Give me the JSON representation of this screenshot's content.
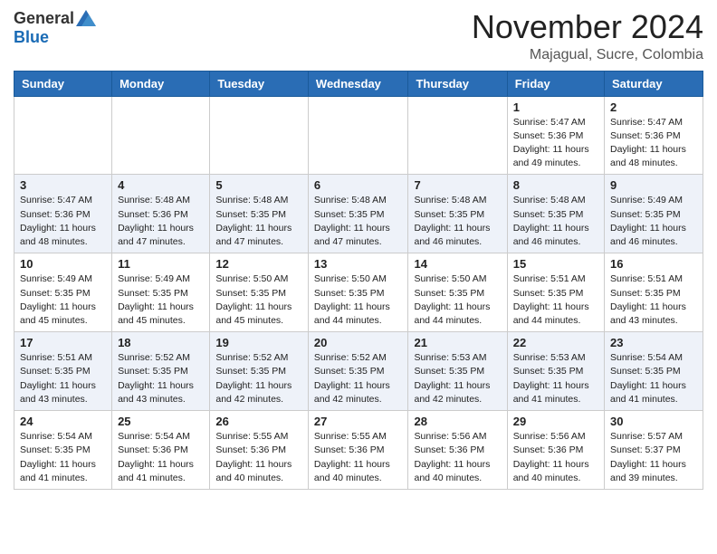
{
  "logo": {
    "general": "General",
    "blue": "Blue"
  },
  "title": "November 2024",
  "location": "Majagual, Sucre, Colombia",
  "header_days": [
    "Sunday",
    "Monday",
    "Tuesday",
    "Wednesday",
    "Thursday",
    "Friday",
    "Saturday"
  ],
  "weeks": [
    [
      {
        "day": "",
        "info": ""
      },
      {
        "day": "",
        "info": ""
      },
      {
        "day": "",
        "info": ""
      },
      {
        "day": "",
        "info": ""
      },
      {
        "day": "",
        "info": ""
      },
      {
        "day": "1",
        "info": "Sunrise: 5:47 AM\nSunset: 5:36 PM\nDaylight: 11 hours\nand 49 minutes."
      },
      {
        "day": "2",
        "info": "Sunrise: 5:47 AM\nSunset: 5:36 PM\nDaylight: 11 hours\nand 48 minutes."
      }
    ],
    [
      {
        "day": "3",
        "info": "Sunrise: 5:47 AM\nSunset: 5:36 PM\nDaylight: 11 hours\nand 48 minutes."
      },
      {
        "day": "4",
        "info": "Sunrise: 5:48 AM\nSunset: 5:36 PM\nDaylight: 11 hours\nand 47 minutes."
      },
      {
        "day": "5",
        "info": "Sunrise: 5:48 AM\nSunset: 5:35 PM\nDaylight: 11 hours\nand 47 minutes."
      },
      {
        "day": "6",
        "info": "Sunrise: 5:48 AM\nSunset: 5:35 PM\nDaylight: 11 hours\nand 47 minutes."
      },
      {
        "day": "7",
        "info": "Sunrise: 5:48 AM\nSunset: 5:35 PM\nDaylight: 11 hours\nand 46 minutes."
      },
      {
        "day": "8",
        "info": "Sunrise: 5:48 AM\nSunset: 5:35 PM\nDaylight: 11 hours\nand 46 minutes."
      },
      {
        "day": "9",
        "info": "Sunrise: 5:49 AM\nSunset: 5:35 PM\nDaylight: 11 hours\nand 46 minutes."
      }
    ],
    [
      {
        "day": "10",
        "info": "Sunrise: 5:49 AM\nSunset: 5:35 PM\nDaylight: 11 hours\nand 45 minutes."
      },
      {
        "day": "11",
        "info": "Sunrise: 5:49 AM\nSunset: 5:35 PM\nDaylight: 11 hours\nand 45 minutes."
      },
      {
        "day": "12",
        "info": "Sunrise: 5:50 AM\nSunset: 5:35 PM\nDaylight: 11 hours\nand 45 minutes."
      },
      {
        "day": "13",
        "info": "Sunrise: 5:50 AM\nSunset: 5:35 PM\nDaylight: 11 hours\nand 44 minutes."
      },
      {
        "day": "14",
        "info": "Sunrise: 5:50 AM\nSunset: 5:35 PM\nDaylight: 11 hours\nand 44 minutes."
      },
      {
        "day": "15",
        "info": "Sunrise: 5:51 AM\nSunset: 5:35 PM\nDaylight: 11 hours\nand 44 minutes."
      },
      {
        "day": "16",
        "info": "Sunrise: 5:51 AM\nSunset: 5:35 PM\nDaylight: 11 hours\nand 43 minutes."
      }
    ],
    [
      {
        "day": "17",
        "info": "Sunrise: 5:51 AM\nSunset: 5:35 PM\nDaylight: 11 hours\nand 43 minutes."
      },
      {
        "day": "18",
        "info": "Sunrise: 5:52 AM\nSunset: 5:35 PM\nDaylight: 11 hours\nand 43 minutes."
      },
      {
        "day": "19",
        "info": "Sunrise: 5:52 AM\nSunset: 5:35 PM\nDaylight: 11 hours\nand 42 minutes."
      },
      {
        "day": "20",
        "info": "Sunrise: 5:52 AM\nSunset: 5:35 PM\nDaylight: 11 hours\nand 42 minutes."
      },
      {
        "day": "21",
        "info": "Sunrise: 5:53 AM\nSunset: 5:35 PM\nDaylight: 11 hours\nand 42 minutes."
      },
      {
        "day": "22",
        "info": "Sunrise: 5:53 AM\nSunset: 5:35 PM\nDaylight: 11 hours\nand 41 minutes."
      },
      {
        "day": "23",
        "info": "Sunrise: 5:54 AM\nSunset: 5:35 PM\nDaylight: 11 hours\nand 41 minutes."
      }
    ],
    [
      {
        "day": "24",
        "info": "Sunrise: 5:54 AM\nSunset: 5:35 PM\nDaylight: 11 hours\nand 41 minutes."
      },
      {
        "day": "25",
        "info": "Sunrise: 5:54 AM\nSunset: 5:36 PM\nDaylight: 11 hours\nand 41 minutes."
      },
      {
        "day": "26",
        "info": "Sunrise: 5:55 AM\nSunset: 5:36 PM\nDaylight: 11 hours\nand 40 minutes."
      },
      {
        "day": "27",
        "info": "Sunrise: 5:55 AM\nSunset: 5:36 PM\nDaylight: 11 hours\nand 40 minutes."
      },
      {
        "day": "28",
        "info": "Sunrise: 5:56 AM\nSunset: 5:36 PM\nDaylight: 11 hours\nand 40 minutes."
      },
      {
        "day": "29",
        "info": "Sunrise: 5:56 AM\nSunset: 5:36 PM\nDaylight: 11 hours\nand 40 minutes."
      },
      {
        "day": "30",
        "info": "Sunrise: 5:57 AM\nSunset: 5:37 PM\nDaylight: 11 hours\nand 39 minutes."
      }
    ]
  ]
}
